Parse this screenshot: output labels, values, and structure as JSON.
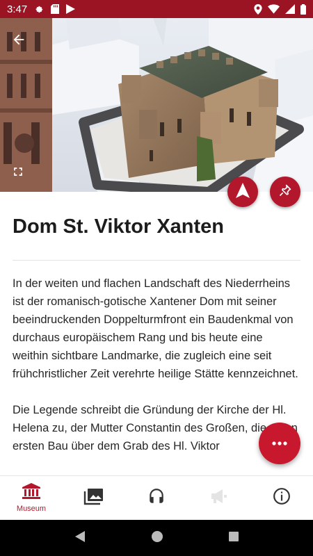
{
  "status_bar": {
    "time": "3:47",
    "left_icons": [
      "gear-icon",
      "sd-card-icon",
      "play-store-icon"
    ],
    "right_icons": [
      "location-icon",
      "wifi-icon",
      "signal-icon",
      "battery-icon"
    ],
    "background": "#9a1424"
  },
  "hero": {
    "image": "3D model of Xanten castle tower with cathedral towers",
    "back_icon": "arrow-back-icon",
    "fullscreen_icon": "fullscreen-icon",
    "buttons": [
      {
        "name": "navigation-button",
        "icon": "navigation-arrow-icon"
      },
      {
        "name": "pin-button",
        "icon": "pin-icon"
      }
    ]
  },
  "content": {
    "title": "Dom St. Viktor Xanten",
    "paragraphs": [
      "In der weiten und flachen Landschaft des Niederrheins ist der romanisch-gotische Xantener Dom mit seiner beeindruckenden Doppelturmfront ein Baudenkmal von durchaus europäischem Rang und bis heute eine weithin sichtbare Landmarke, die zugleich eine seit frühchristlicher Zeit verehrte heilige Stätte kennzeichnet.",
      "Die Legende schreibt die Gründung der Kirche der Hl. Helena zu, der Mutter Constantin des Großen, die einen ersten Bau über dem Grab des Hl. Viktor"
    ]
  },
  "more_button": {
    "icon": "more-horizontal-icon"
  },
  "bottom_nav": {
    "items": [
      {
        "label": "Museum",
        "icon": "museum-icon",
        "active": true
      },
      {
        "label": "",
        "icon": "gallery-icon",
        "active": false
      },
      {
        "label": "",
        "icon": "headphones-icon",
        "active": false
      },
      {
        "label": "",
        "icon": "megaphone-icon",
        "active": false,
        "disabled": true
      },
      {
        "label": "",
        "icon": "info-icon",
        "active": false
      }
    ]
  },
  "colors": {
    "accent": "#b3172b",
    "status_bar": "#9a1424"
  }
}
